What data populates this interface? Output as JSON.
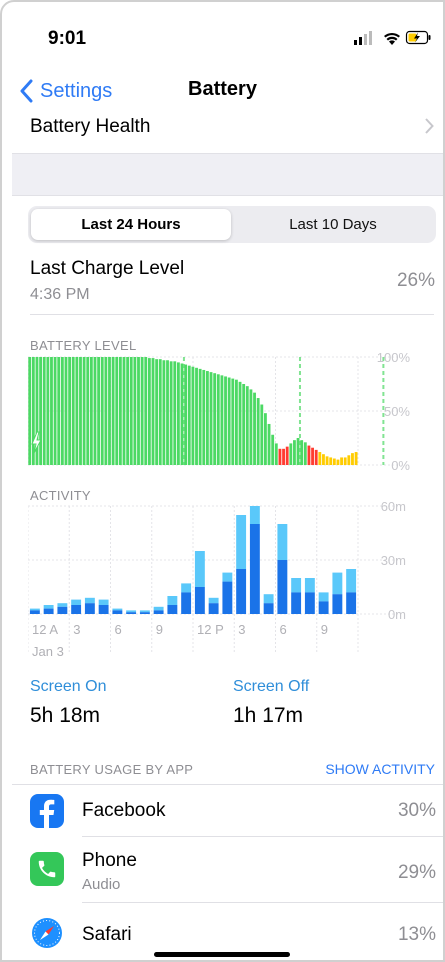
{
  "status": {
    "time": "9:01"
  },
  "nav": {
    "back_label": "Settings",
    "title": "Battery"
  },
  "battery_health": {
    "label": "Battery Health"
  },
  "segment": {
    "options": [
      "Last 24 Hours",
      "Last 10 Days"
    ],
    "selected": "Last 24 Hours"
  },
  "last_charge": {
    "title": "Last Charge Level",
    "time": "4:36 PM",
    "value": "26%"
  },
  "battery_level": {
    "label": "BATTERY LEVEL",
    "y_ticks": [
      "100%",
      "50%",
      "0%"
    ]
  },
  "activity": {
    "label": "ACTIVITY",
    "y_ticks": [
      "60m",
      "30m",
      "0m"
    ],
    "x_ticks": [
      "12 A",
      "3",
      "6",
      "9",
      "12 P",
      "3",
      "6",
      "9"
    ],
    "date_label": "Jan 3"
  },
  "chart_data": [
    {
      "type": "bar",
      "title": "BATTERY LEVEL",
      "ylabel": "",
      "ylim": [
        0,
        100
      ],
      "values": [
        100,
        100,
        100,
        100,
        100,
        100,
        100,
        100,
        100,
        100,
        100,
        100,
        100,
        100,
        100,
        100,
        100,
        100,
        100,
        100,
        100,
        100,
        100,
        100,
        100,
        100,
        100,
        100,
        100,
        100,
        100,
        100,
        100,
        99,
        99,
        98,
        98,
        97,
        97,
        96,
        96,
        95,
        94,
        93,
        92,
        91,
        90,
        89,
        88,
        87,
        86,
        85,
        84,
        83,
        82,
        81,
        80,
        79,
        77,
        75,
        73,
        70,
        67,
        62,
        56,
        48,
        38,
        28,
        20,
        15,
        15,
        17,
        20,
        23,
        25,
        23,
        21,
        18,
        16,
        14,
        12,
        10,
        8,
        7,
        6,
        5,
        7,
        7,
        9,
        11,
        12
      ],
      "colors": {
        "normal": "#4cd964",
        "low": "#ff3b30",
        "low_power": "#ffcc00"
      },
      "charging_markers_at_index": [
        43,
        75,
        98
      ]
    },
    {
      "type": "bar",
      "title": "ACTIVITY",
      "ylabel": "",
      "ylim": [
        0,
        60
      ],
      "categories": [
        "0",
        "1",
        "2",
        "3",
        "4",
        "5",
        "6",
        "7",
        "8",
        "9",
        "10",
        "11",
        "12",
        "13",
        "14",
        "15",
        "16",
        "17",
        "18",
        "19",
        "20",
        "21",
        "22",
        "23"
      ],
      "series": [
        {
          "name": "Screen On",
          "values": [
            2,
            3,
            4,
            5,
            6,
            5,
            2,
            1,
            1,
            2,
            5,
            12,
            15,
            6,
            18,
            25,
            50,
            6,
            30,
            12,
            12,
            7,
            11,
            12
          ]
        },
        {
          "name": "Screen Off",
          "values": [
            1,
            2,
            2,
            3,
            3,
            3,
            1,
            1,
            1,
            2,
            5,
            5,
            20,
            3,
            5,
            30,
            10,
            5,
            20,
            8,
            8,
            5,
            12,
            13
          ]
        }
      ],
      "colors": {
        "screen_on": "#1a73e8",
        "screen_off": "#5ac8fa"
      }
    }
  ],
  "screen_on": {
    "label": "Screen On",
    "value": "5h 18m"
  },
  "screen_off": {
    "label": "Screen Off",
    "value": "1h 17m"
  },
  "usage": {
    "header": "BATTERY USAGE BY APP",
    "show_activity": "SHOW ACTIVITY",
    "apps": [
      {
        "name": "Facebook",
        "sub": "",
        "pct": "30%",
        "icon": "facebook-icon",
        "color": "#1877f2"
      },
      {
        "name": "Phone",
        "sub": "Audio",
        "pct": "29%",
        "icon": "phone-icon",
        "color": "#34c759"
      },
      {
        "name": "Safari",
        "sub": "",
        "pct": "13%",
        "icon": "safari-icon",
        "color": "#1e90ff"
      }
    ]
  }
}
